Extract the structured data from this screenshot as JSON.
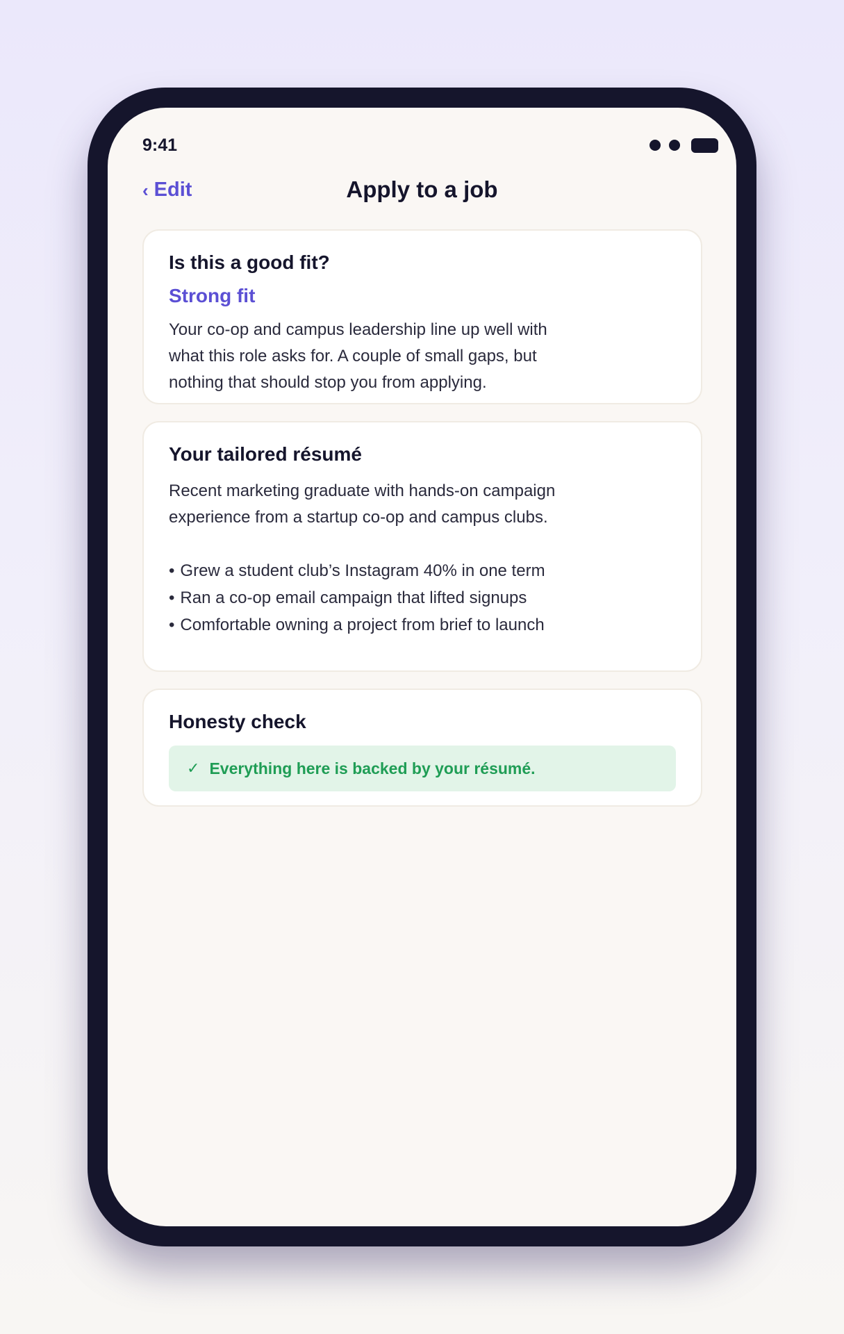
{
  "status_bar": {
    "time": "9:41"
  },
  "nav": {
    "back_chevron": "‹",
    "back_label": "Edit",
    "title": "Apply to a job"
  },
  "fit_card": {
    "title": "Is this a good fit?",
    "level": "Strong fit",
    "description": "Your co-op and campus leadership line up well with what this role asks for. A couple of small gaps, but nothing that should stop you from applying."
  },
  "resume_card": {
    "title": "Your tailored résumé",
    "summary": "Recent marketing graduate with hands-on campaign experience from a startup co-op and campus clubs.",
    "bullet_marker": "•",
    "bullets": [
      "Grew a student club’s Instagram 40% in one term",
      "Ran a co-op email campaign that lifted signups",
      "Comfortable owning a project from brief to launch"
    ]
  },
  "honesty_card": {
    "title": "Honesty check",
    "check_mark": "✓",
    "message": "Everything here is backed by your résumé."
  },
  "colors": {
    "accent": "#5b4fd4",
    "success_text": "#1f9d55",
    "success_bg": "#e2f4e8",
    "device_frame": "#15152c",
    "screen_bg": "#faf7f4"
  }
}
